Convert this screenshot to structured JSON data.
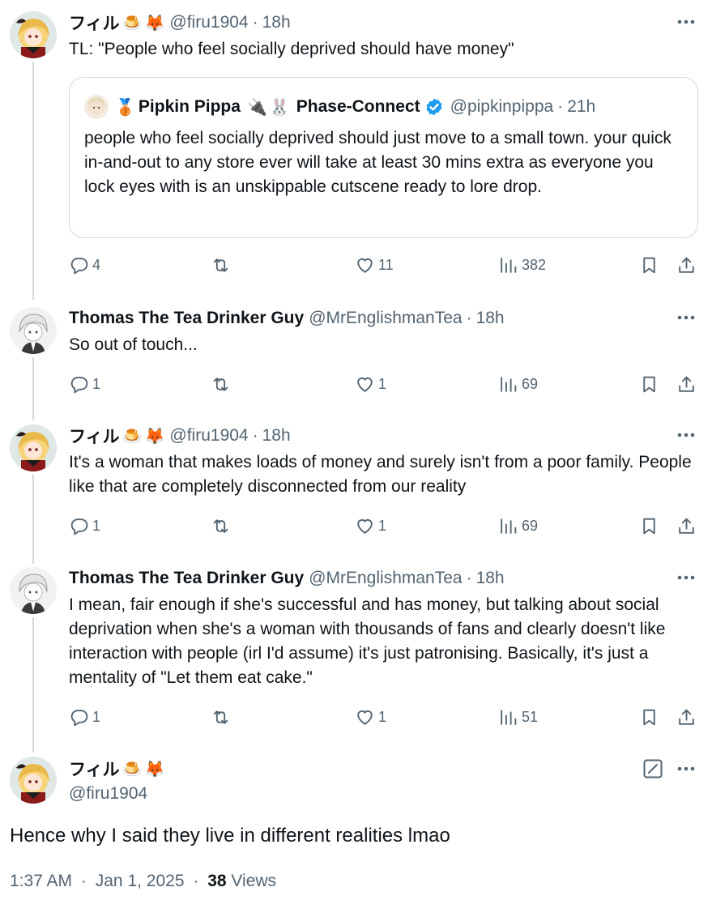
{
  "thread": [
    {
      "name": "フィル",
      "emojis": [
        "🍮",
        "🦊"
      ],
      "handle": "@firu1904",
      "time": "18h",
      "text": "TL: \"People who feel socially deprived should have money\"",
      "quote": {
        "name": "Pipkin Pippa",
        "badge_emoji": "🥉",
        "affiliation_emojis": [
          "🔌",
          "🐰"
        ],
        "affiliation": "Phase-Connect",
        "handle": "@pipkinpippa",
        "time": "21h",
        "text": "people who feel socially deprived should just move to a small town. your quick in-and-out to any store ever will take at least 30 mins extra as everyone you lock eyes with is an unskippable cutscene ready to lore drop."
      },
      "replies": "4",
      "reposts": "",
      "likes": "11",
      "views": "382"
    },
    {
      "name": "Thomas The Tea Drinker Guy",
      "handle": "@MrEnglishmanTea",
      "time": "18h",
      "text": "So out of touch...",
      "replies": "1",
      "reposts": "",
      "likes": "1",
      "views": "69"
    },
    {
      "name": "フィル",
      "emojis": [
        "🍮",
        "🦊"
      ],
      "handle": "@firu1904",
      "time": "18h",
      "text": "It's a woman that makes loads of money and surely isn't from a poor family. People like that are completely disconnected from our reality",
      "replies": "1",
      "reposts": "",
      "likes": "1",
      "views": "69"
    },
    {
      "name": "Thomas The Tea Drinker Guy",
      "handle": "@MrEnglishmanTea",
      "time": "18h",
      "text": "I mean, fair enough if she's successful and has money, but talking about social deprivation when she's a woman with thousands of fans and clearly doesn't like interaction with people (irl I'd assume) it's just patronising. Basically, it's just a mentality of \"Let them eat cake.\"",
      "replies": "1",
      "reposts": "",
      "likes": "1",
      "views": "51"
    }
  ],
  "main": {
    "name": "フィル",
    "emojis": [
      "🍮",
      "🦊"
    ],
    "handle": "@firu1904",
    "text": "Hence why I said they live in different realities lmao",
    "time": "1:37 AM",
    "date": "Jan 1, 2025",
    "views_count": "38",
    "views_label": "Views"
  },
  "separator": "·",
  "colors": {
    "text": "#0f1419",
    "secondary": "#536471",
    "border": "#cfd9de",
    "verified": "#1d9bf0"
  },
  "icons": [
    "reply-icon",
    "repost-icon",
    "like-icon",
    "views-icon",
    "bookmark-icon",
    "share-icon",
    "more-icon",
    "edit-icon",
    "verified-icon"
  ]
}
